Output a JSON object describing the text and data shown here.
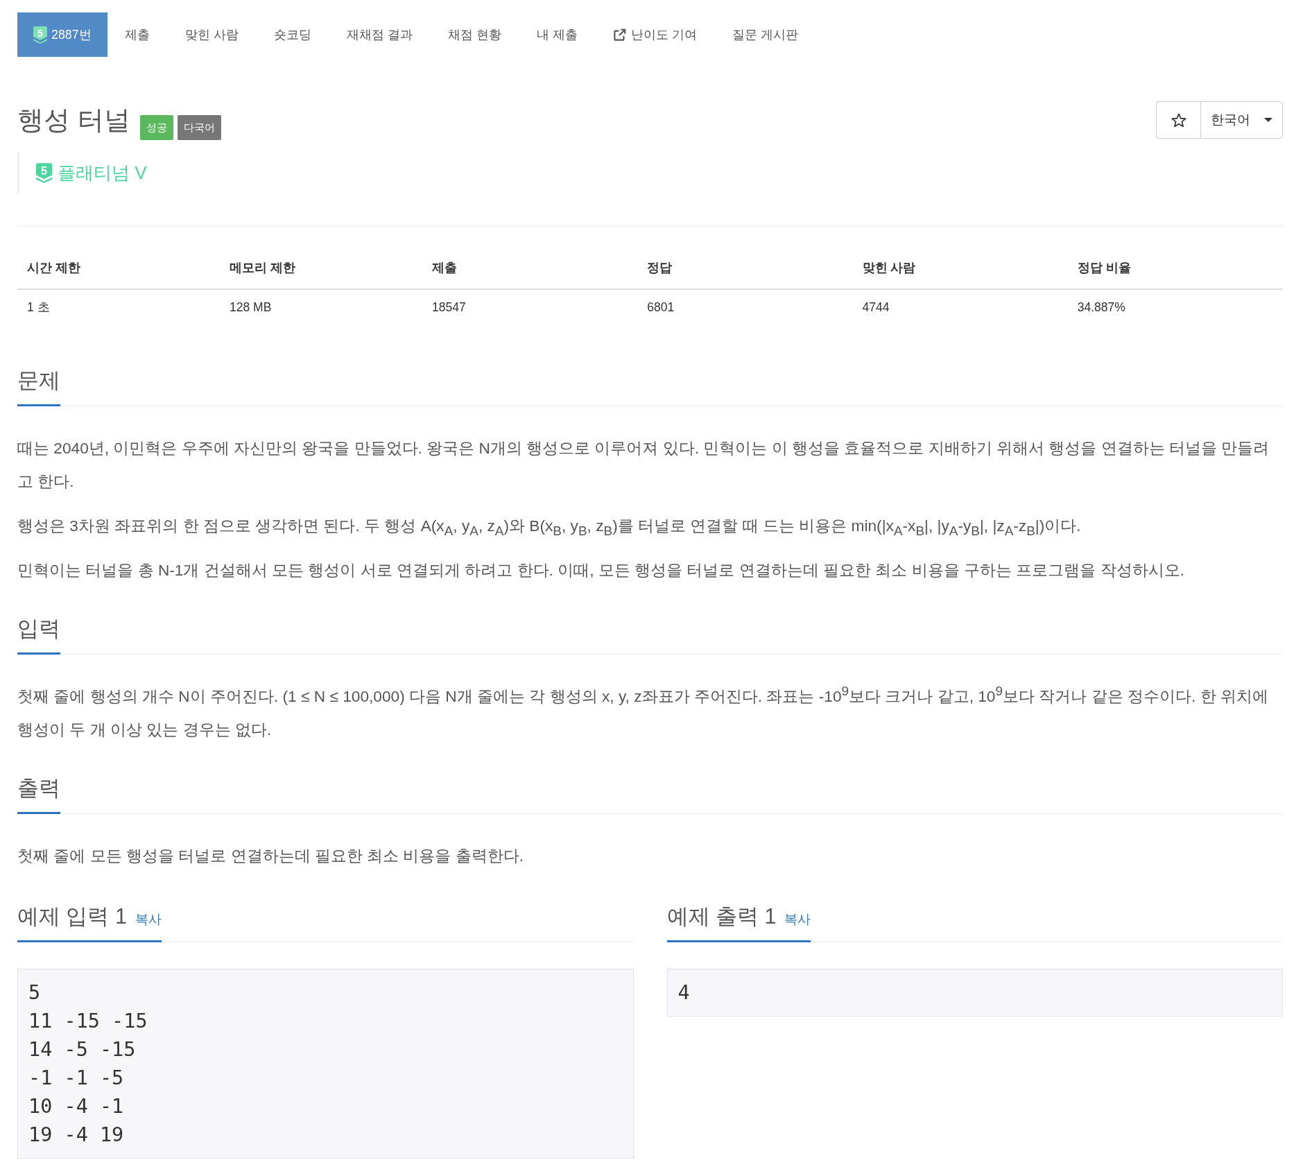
{
  "nav": {
    "tabs": [
      {
        "label": "2887번",
        "kind": "tier",
        "badge": "5",
        "selected": true
      },
      {
        "label": "제출",
        "kind": "plain",
        "selected": false
      },
      {
        "label": "맞힌 사람",
        "kind": "plain",
        "selected": false
      },
      {
        "label": "숏코딩",
        "kind": "plain",
        "selected": false
      },
      {
        "label": "재채점 결과",
        "kind": "plain",
        "selected": false
      },
      {
        "label": "채점 현황",
        "kind": "plain",
        "selected": false
      },
      {
        "label": "내 제출",
        "kind": "plain",
        "selected": false
      },
      {
        "label": "난이도 기여",
        "kind": "external",
        "selected": false
      },
      {
        "label": "질문 게시판",
        "kind": "plain",
        "selected": false
      }
    ]
  },
  "problem": {
    "title": "행성 터널",
    "labels": [
      {
        "text": "성공",
        "color": "#5cb85c"
      },
      {
        "text": "다국어",
        "color": "#777777"
      }
    ],
    "tier": {
      "badge": "5",
      "name": "플래티넘 V"
    },
    "language": "한국어"
  },
  "stats": {
    "columns": [
      "시간 제한",
      "메모리 제한",
      "제출",
      "정답",
      "맞힌 사람",
      "정답 비율"
    ],
    "rows": [
      [
        "1 초",
        "128 MB",
        "18547",
        "6801",
        "4744",
        "34.887%"
      ]
    ]
  },
  "sections": [
    {
      "heading": "문제",
      "paragraphs": [
        "때는 2040년, 이민혁은 우주에 자신만의 왕국을 만들었다. 왕국은 N개의 행성으로 이루어져 있다. 민혁이는 이 행성을 효율적으로 지배하기 위해서 행성을 연결하는 터널을 만들려고 한다.",
        "행성은 3차원 좌표위의 한 점으로 생각하면 된다. 두 행성 A(x$_{A}$, y$_{A}$, z$_{A}$)와 B(x$_{B}$, y$_{B}$, z$_{B}$)를 터널로 연결할 때 드는 비용은 min(|x$_{A}$-x$_{B}$|, |y$_{A}$-y$_{B}$|, |z$_{A}$-z$_{B}$|)이다.",
        "민혁이는 터널을 총 N-1개 건설해서 모든 행성이 서로 연결되게 하려고 한다. 이때, 모든 행성을 터널로 연결하는데 필요한 최소 비용을 구하는 프로그램을 작성하시오."
      ]
    },
    {
      "heading": "입력",
      "paragraphs": [
        "첫째 줄에 행성의 개수 N이 주어진다. (1 ≤ N ≤ 100,000) 다음 N개 줄에는 각 행성의 x, y, z좌표가 주어진다. 좌표는 -10$^{9}$보다 크거나 같고, 10$^{9}$보다 작거나 같은 정수이다. 한 위치에 행성이 두 개 이상 있는 경우는 없다."
      ]
    },
    {
      "heading": "출력",
      "paragraphs": [
        "첫째 줄에 모든 행성을 터널로 연결하는데 필요한 최소 비용을 출력한다."
      ]
    }
  ],
  "samples": [
    {
      "heading": "예제 입력 1",
      "copy": "복사",
      "lines": [
        "5",
        "11 -15 -15",
        "14 -5 -15",
        "-1 -1 -5",
        "10 -4 -1",
        "19 -4 19"
      ]
    },
    {
      "heading": "예제 출력 1",
      "copy": "복사",
      "lines": [
        "4"
      ]
    }
  ]
}
